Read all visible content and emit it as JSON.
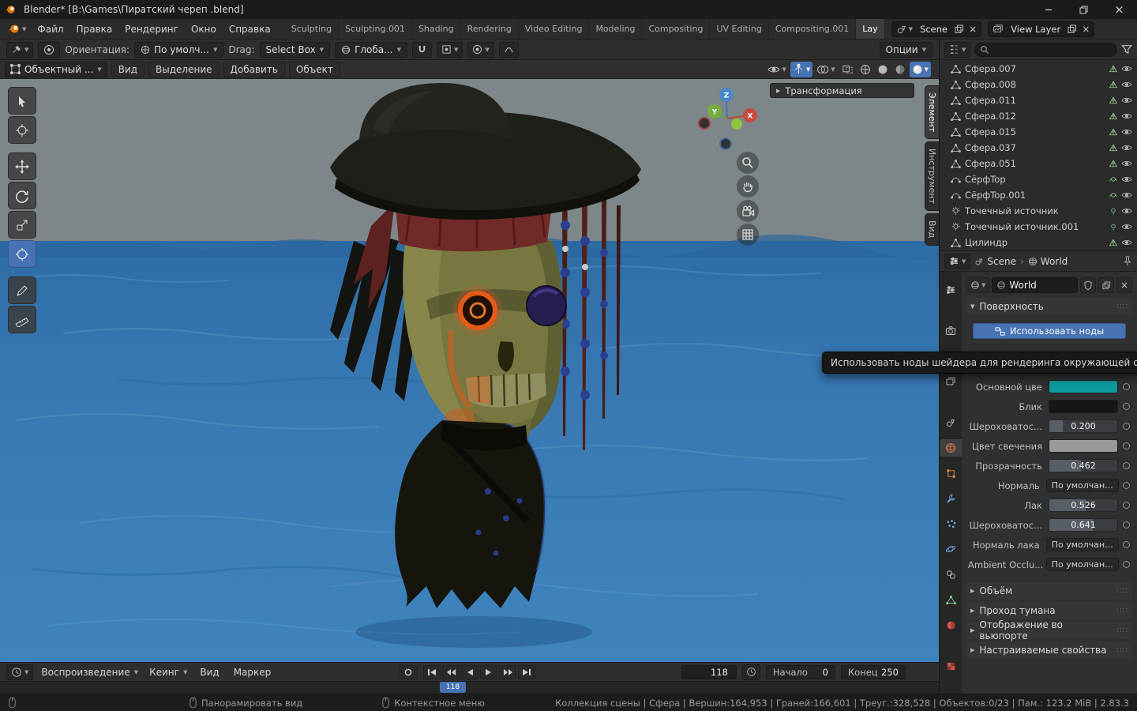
{
  "window": {
    "title": "Blender* [B:\\Games\\Пиратский череп .blend]"
  },
  "topbar": {
    "menus": [
      {
        "label": "Файл"
      },
      {
        "label": "Правка"
      },
      {
        "label": "Рендеринг"
      },
      {
        "label": "Окно"
      },
      {
        "label": "Справка"
      }
    ],
    "workspaces": [
      {
        "label": "Sculpting"
      },
      {
        "label": "Sculpting.001"
      },
      {
        "label": "Shading"
      },
      {
        "label": "Rendering"
      },
      {
        "label": "Video Editing"
      },
      {
        "label": "Modeling"
      },
      {
        "label": "Compositing"
      },
      {
        "label": "UV Editing"
      },
      {
        "label": "Compositing.001"
      },
      {
        "label": "Lay"
      }
    ],
    "scene_value": "Scene",
    "view_layer_value": "View Layer"
  },
  "tool_settings": {
    "orientation_label": "Ориентация:",
    "orientation_value": "По умолч...",
    "drag_label": "Drag:",
    "drag_value": "Select Box",
    "pivot_value": "Глоба...",
    "options_label": "Опции"
  },
  "viewport": {
    "mode_value": "Объектный ...",
    "menus": [
      {
        "label": "Вид"
      },
      {
        "label": "Выделение"
      },
      {
        "label": "Добавить"
      },
      {
        "label": "Объект"
      }
    ],
    "transform_panel_label": "Трансформация",
    "side_tabs": [
      {
        "label": "Элемент"
      },
      {
        "label": "Инструмент"
      },
      {
        "label": "Вид"
      }
    ],
    "axis": {
      "x": "X",
      "y": "Y",
      "z": "Z"
    }
  },
  "outliner": {
    "items": [
      {
        "name": "Сфера.007"
      },
      {
        "name": "Сфера.008"
      },
      {
        "name": "Сфера.011"
      },
      {
        "name": "Сфера.012"
      },
      {
        "name": "Сфера.015"
      },
      {
        "name": "Сфера.037"
      },
      {
        "name": "Сфера.051"
      },
      {
        "name": "СёрфTop"
      },
      {
        "name": "СёрфTop.001"
      },
      {
        "name": "Точечный источник"
      },
      {
        "name": "Точечный источник.001"
      },
      {
        "name": "Цилиндр"
      }
    ]
  },
  "properties": {
    "breadcrumb_scene": "Scene",
    "breadcrumb_world": "World",
    "datablock_value": "World",
    "surface_section_label": "Поверхность",
    "use_nodes_label": "Использовать ноды",
    "tooltip_text": "Использовать ноды шейдера для рендеринга окружающей среды.",
    "rows": [
      {
        "label": "Основной цве",
        "swatch_css": "background:#0e9c9e"
      },
      {
        "label": "Блик",
        "swatch_css": "background:#161616"
      },
      {
        "label": "Шероховатос...",
        "value": "0.200",
        "fill_css": "width:20%"
      },
      {
        "label": "Цвет свечения",
        "swatch_css": "background:#9a9a9a"
      },
      {
        "label": "Прозрачность",
        "value": "0.462",
        "fill_css": "width:46%"
      },
      {
        "label": "Нормаль",
        "value": "По умолчан..."
      },
      {
        "label": "Лак",
        "value": "0.526",
        "fill_css": "width:53%"
      },
      {
        "label": "Шероховатос...",
        "value": "0.641",
        "fill_css": "width:64%"
      },
      {
        "label": "Нормаль лака",
        "value": "По умолчан..."
      },
      {
        "label": "Ambient Occlu...",
        "value": "По умолчан..."
      }
    ],
    "sections": [
      {
        "label": "Объём"
      },
      {
        "label": "Проход тумана"
      },
      {
        "label": "Отображение во вьюпорте"
      },
      {
        "label": "Настраиваемые свойства"
      }
    ]
  },
  "timeline": {
    "menus": [
      {
        "label": "Воспроизведение"
      },
      {
        "label": "Кеинг"
      },
      {
        "label": "Вид"
      },
      {
        "label": "Маркер"
      }
    ],
    "current_frame": "118",
    "start_label": "Начало",
    "start_value": "0",
    "end_label": "Конец",
    "end_value": "250"
  },
  "statusbar": {
    "hint1": "Панорамировать вид",
    "hint2": "Контекстное меню",
    "stats": "Коллекция сцены | Сфера | Вершин:164,953 | Граней:166,601 | Треуг.:328,528 | Объектов:0/23 | Пам.: 123.2 MiB | 2.83.3"
  },
  "colors": {
    "accent": "#4772b3",
    "world_color": "#0e9c9e"
  }
}
